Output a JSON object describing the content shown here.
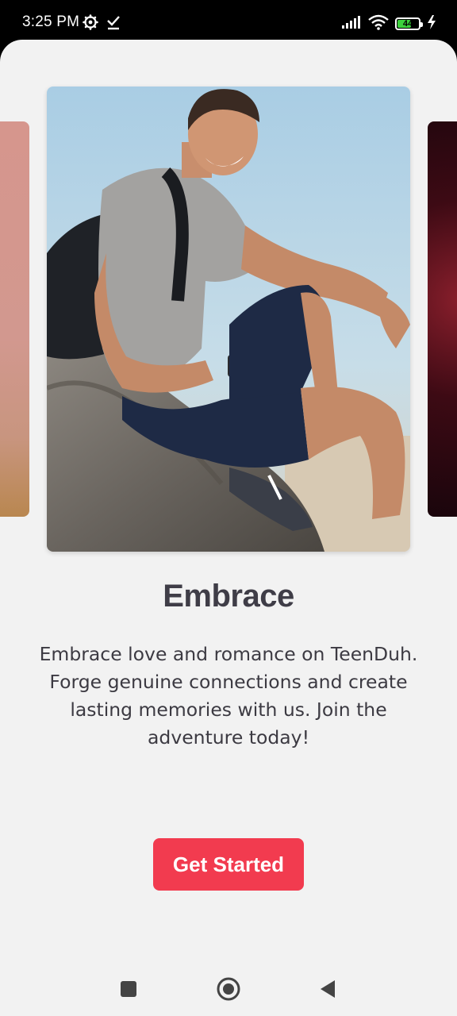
{
  "status_bar": {
    "time": "3:25 PM",
    "left_icons": [
      "settings-gear-icon",
      "download-done-icon"
    ],
    "right_icons": [
      "signal-icon",
      "wifi-icon",
      "battery-icon",
      "charging-bolt-icon"
    ],
    "battery_level": "44",
    "battery_color": "#3dd13d"
  },
  "carousel": {
    "cards": [
      {
        "name": "left-card",
        "dominant_color": "#d2988f"
      },
      {
        "name": "center-card",
        "subject": "smiling man sitting on a rock with backpack"
      },
      {
        "name": "right-card",
        "dominant_color": "#3d0a14"
      }
    ]
  },
  "onboarding": {
    "title": "Embrace",
    "description": "Embrace love and romance on TeenDuh. Forge genuine connections and create lasting memories with us. Join the adventure today!",
    "cta_label": "Get Started",
    "cta_color": "#f23b4f"
  },
  "nav_bar": {
    "buttons": [
      "recent-apps-icon",
      "home-icon",
      "back-icon"
    ]
  }
}
